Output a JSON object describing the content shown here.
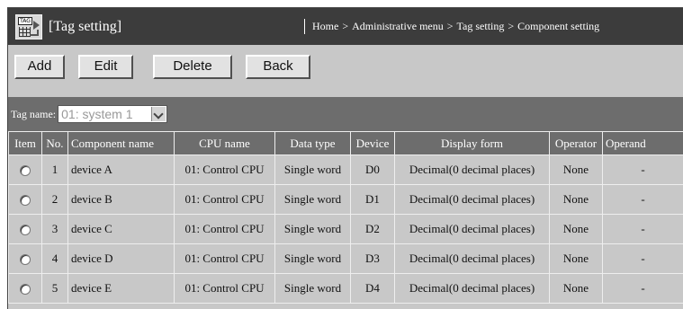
{
  "header": {
    "icon": "tag-setting-icon",
    "icon_text": "TAG",
    "title": "[Tag setting]",
    "breadcrumb": [
      "Home",
      "Administrative menu",
      "Tag setting",
      "Component setting"
    ],
    "breadcrumb_separator": ">"
  },
  "toolbar": {
    "add_label": "Add",
    "edit_label": "Edit",
    "delete_label": "Delete",
    "back_label": "Back"
  },
  "tag": {
    "label": "Tag name:",
    "selected": "01: system 1"
  },
  "table": {
    "columns": [
      "Item",
      "No.",
      "Component name",
      "CPU name",
      "Data type",
      "Device",
      "Display form",
      "Operator",
      "Operand"
    ],
    "rows": [
      {
        "no": "1",
        "name": "device A",
        "cpu": "01: Control CPU",
        "type": "Single word",
        "device": "D0",
        "display": "Decimal(0 decimal places)",
        "operator": "None",
        "operand": "-"
      },
      {
        "no": "2",
        "name": "device B",
        "cpu": "01: Control CPU",
        "type": "Single word",
        "device": "D1",
        "display": "Decimal(0 decimal places)",
        "operator": "None",
        "operand": "-"
      },
      {
        "no": "3",
        "name": "device C",
        "cpu": "01: Control CPU",
        "type": "Single word",
        "device": "D2",
        "display": "Decimal(0 decimal places)",
        "operator": "None",
        "operand": "-"
      },
      {
        "no": "4",
        "name": "device D",
        "cpu": "01: Control CPU",
        "type": "Single word",
        "device": "D3",
        "display": "Decimal(0 decimal places)",
        "operator": "None",
        "operand": "-"
      },
      {
        "no": "5",
        "name": "device E",
        "cpu": "01: Control CPU",
        "type": "Single word",
        "device": "D4",
        "display": "Decimal(0 decimal places)",
        "operator": "None",
        "operand": "-"
      }
    ]
  },
  "colors": {
    "header_bg": "#3c3c3c",
    "panel_bg": "#c8c8c8",
    "table_header_bg": "#6d6d6d"
  }
}
